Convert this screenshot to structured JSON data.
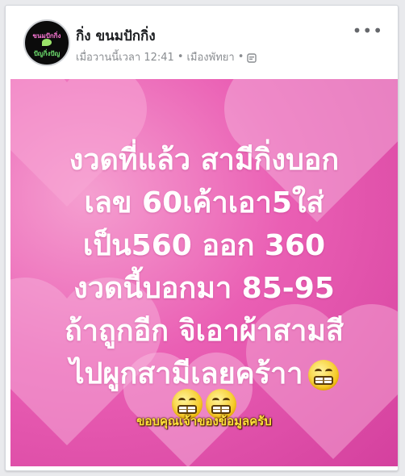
{
  "post": {
    "author": "กิ่ง ขนมปักกิ่ง",
    "timestamp": "เมื่อวานนี้เวลา 12:41",
    "separator": "•",
    "location": "เมืองพัทยา",
    "more_label": "•••",
    "privacy_icon": "globe-icon"
  },
  "avatar": {
    "line1": "ขนมปักกิ่ง",
    "line2": "ปัญกิ่งปัญ"
  },
  "image": {
    "lines": [
      "งวดที่แล้ว สามีกิ่งบอก",
      "เลข 60เค้าเอา5ใส่",
      "เป็น560  ออก 360",
      "งวดนี้บอกมา  85-95",
      "ถ้าถูกอีก จิเอาผ้าสามสี",
      "ไปผูกสามีเลยคร้าา"
    ],
    "emoji": "grimacing-face-icon",
    "caption": "ขอบคุณเจ้าของข้อมูลครับ"
  },
  "colors": {
    "background_pink": "#ea5fb4",
    "caption_yellow": "#ffe13a"
  }
}
